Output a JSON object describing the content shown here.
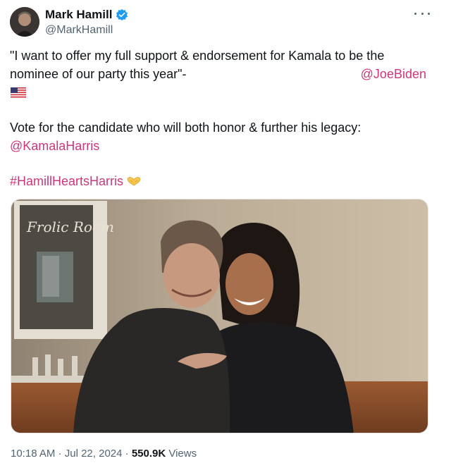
{
  "author": {
    "name": "Mark Hamill",
    "handle": "@MarkHamill",
    "verified": true,
    "avatar_icon": "avatar-photo"
  },
  "more_icon": "more-horizontal-icon",
  "tweet": {
    "line1": "\"I want to offer my full support & endorsement for Kamala to be the",
    "line2_text": "nominee of our party this year\"-",
    "mention_biden": "@JoeBiden",
    "flag_icon": "us-flag-icon",
    "line3": "Vote for the candidate who will both honor & further his legacy:",
    "mention_harris": "@KamalaHarris",
    "hashtag": "#HamillHeartsHarris",
    "hashtag_icon": "heart-hands-icon"
  },
  "media": {
    "sign_text": "Frolic Room"
  },
  "meta": {
    "time": "10:18 AM",
    "separator1": " · ",
    "date": "Jul 22, 2024",
    "separator2": " · ",
    "views_count": "550.9K",
    "views_label": " Views"
  },
  "colors": {
    "link": "#c9377e",
    "text": "#0f1419",
    "secondary": "#536471",
    "verified": "#1d9bf0"
  }
}
